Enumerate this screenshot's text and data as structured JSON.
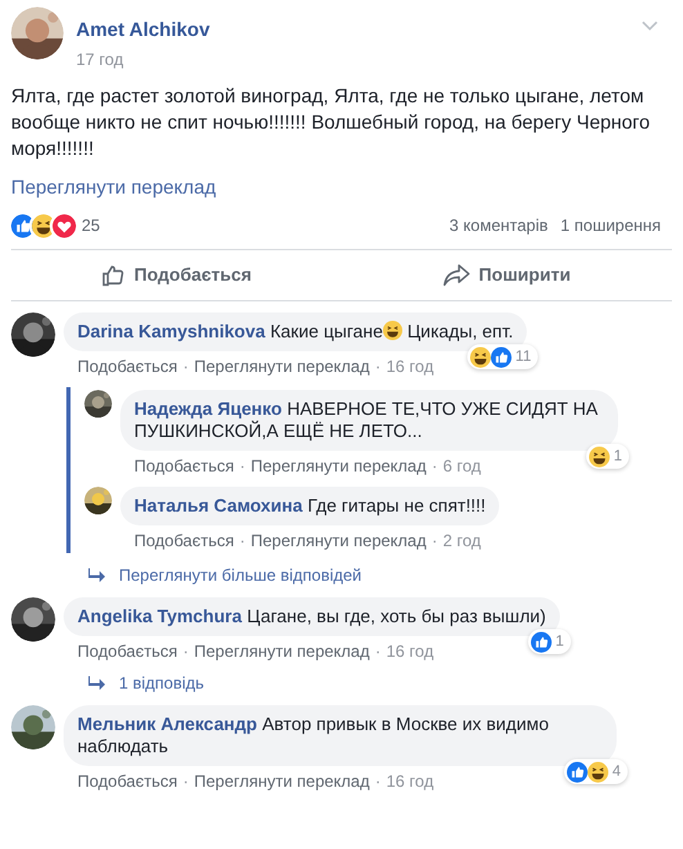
{
  "post": {
    "author": "Amet Alchikov",
    "time": "17 год",
    "text": "Ялта, где растет золотой виноград, Ялта, где не только цыгане, летом вообще никто не спит ночью!!!!!!! Волшебный город, на берегу Черного моря!!!!!!!",
    "translate_link": "Переглянути переклад",
    "reactions": [
      {
        "kind": "like"
      },
      {
        "kind": "haha"
      },
      {
        "kind": "love"
      }
    ],
    "reaction_count": "25",
    "comments_count": "3 коментарів",
    "shares_count": "1 поширення",
    "actions": [
      {
        "kind": "like",
        "label": "Подобається"
      },
      {
        "kind": "share",
        "label": "Поширити"
      }
    ]
  },
  "comments": [
    {
      "kind": "comment",
      "author": "Darina Kamyshnikova",
      "segments": [
        {
          "kind": "text",
          "text": "Какие цыгане"
        },
        {
          "kind": "haha"
        },
        {
          "kind": "text",
          "text": " Цикады, епт."
        }
      ],
      "actions": [
        "Подобається",
        "Переглянути переклад"
      ],
      "separator": "·",
      "time": "16 год",
      "reactions": [
        {
          "kind": "haha"
        },
        {
          "kind": "like"
        }
      ],
      "reaction_count": "11",
      "replies": [
        {
          "author": "Надежда Яценко",
          "segments": [
            {
              "kind": "text",
              "text": "НАВЕРНОЕ ТЕ,ЧТО УЖЕ СИДЯТ НА ПУШКИНСКОЙ,А ЕЩЁ НЕ ЛЕТО..."
            }
          ],
          "actions": [
            "Подобається",
            "Переглянути переклад"
          ],
          "separator": "·",
          "time": "6 год",
          "reactions": [
            {
              "kind": "haha"
            }
          ],
          "reaction_count": "1"
        },
        {
          "author": "Наталья Самохина",
          "segments": [
            {
              "kind": "text",
              "text": "Где гитары не спят!!!!"
            }
          ],
          "actions": [
            "Подобається",
            "Переглянути переклад"
          ],
          "separator": "·",
          "time": "2 год"
        }
      ]
    },
    {
      "kind": "more_replies",
      "label": "Переглянути більше відповідей"
    },
    {
      "kind": "comment",
      "author": "Angelika Tymchura",
      "segments": [
        {
          "kind": "text",
          "text": "Цагане, вы где, хоть бы раз вышли)"
        }
      ],
      "actions": [
        "Подобається",
        "Переглянути переклад"
      ],
      "separator": "·",
      "time": "16 год",
      "reactions": [
        {
          "kind": "like"
        }
      ],
      "reaction_count": "1"
    },
    {
      "kind": "more_replies",
      "label": "1 відповідь"
    },
    {
      "kind": "comment",
      "author": "Мельник Александр",
      "segments": [
        {
          "kind": "text",
          "text": "Автор привык в Москве их видимо наблюдать"
        }
      ],
      "actions": [
        "Подобається",
        "Переглянути переклад"
      ],
      "separator": "·",
      "time": "16 год",
      "reactions": [
        {
          "kind": "like"
        },
        {
          "kind": "haha"
        }
      ],
      "reaction_count": "4"
    }
  ]
}
